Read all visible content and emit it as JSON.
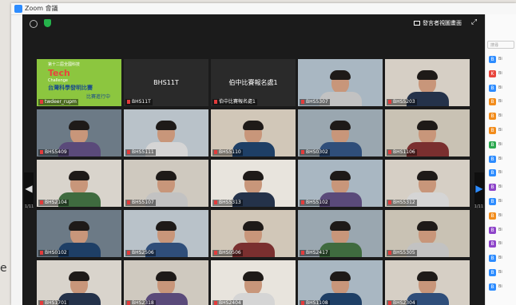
{
  "window": {
    "title": "Zoom 會議"
  },
  "toolbar": {
    "view_label": "發言者視圖畫面",
    "fullscreen_icon": "fullscreen-icon"
  },
  "navigation": {
    "prev_page": "1/11",
    "next_page": "1/11"
  },
  "sidebar": {
    "search_placeholder": "搜尋",
    "items": [
      {
        "avatar": "B",
        "label": "Bi",
        "color": "#2d8cff"
      },
      {
        "avatar": "K",
        "label": "Bi",
        "color": "#e8453c"
      },
      {
        "avatar": "B",
        "label": "Bi",
        "color": "#2d8cff"
      },
      {
        "avatar": "B",
        "label": "Bi",
        "color": "#f28c1b"
      },
      {
        "avatar": "B",
        "label": "Bi",
        "color": "#f28c1b"
      },
      {
        "avatar": "B",
        "label": "Bi",
        "color": "#f28c1b"
      },
      {
        "avatar": "B",
        "label": "Bi",
        "color": "#2ca84f"
      },
      {
        "avatar": "B",
        "label": "Bi",
        "color": "#2d8cff"
      },
      {
        "avatar": "B",
        "label": "Bi",
        "color": "#2d8cff"
      },
      {
        "avatar": "B",
        "label": "Bi",
        "color": "#8e44c9"
      },
      {
        "avatar": "B",
        "label": "Bi",
        "color": "#2d8cff"
      },
      {
        "avatar": "B",
        "label": "Bi",
        "color": "#f28c1b"
      },
      {
        "avatar": "B",
        "label": "Bi",
        "color": "#8e44c9"
      },
      {
        "avatar": "B",
        "label": "Bi",
        "color": "#8e44c9"
      },
      {
        "avatar": "B",
        "label": "Bi",
        "color": "#2d8cff"
      },
      {
        "avatar": "B",
        "label": "Bi",
        "color": "#2d8cff"
      },
      {
        "avatar": "B",
        "label": "Bi",
        "color": "#2d8cff"
      }
    ]
  },
  "tiles": [
    {
      "name": "twdeer_rupm",
      "type": "banner",
      "banner_top": "第十二屆全國科技",
      "banner_brand": "Tech",
      "banner_sub": "Challenge",
      "banner_main": "台灣科學發明比賽",
      "banner_foot": "比賽進行中"
    },
    {
      "name": "BHS11T",
      "type": "label"
    },
    {
      "name": "伯中比賽報名處1",
      "type": "label"
    },
    {
      "name": "BHS5307",
      "type": "video"
    },
    {
      "name": "BHS5203",
      "type": "video"
    },
    {
      "name": "BHS5409",
      "type": "video"
    },
    {
      "name": "BHS5111",
      "type": "video"
    },
    {
      "name": "BHS5110",
      "type": "video"
    },
    {
      "name": "BHS0302",
      "type": "video"
    },
    {
      "name": "BHS1106",
      "type": "video"
    },
    {
      "name": "BHS2104",
      "type": "video"
    },
    {
      "name": "BHS5107",
      "type": "video"
    },
    {
      "name": "BHS5313",
      "type": "video"
    },
    {
      "name": "BHS5102",
      "type": "video"
    },
    {
      "name": "BHS5312",
      "type": "video"
    },
    {
      "name": "BHS0102",
      "type": "video"
    },
    {
      "name": "BHS2506",
      "type": "video"
    },
    {
      "name": "BHS0506",
      "type": "video"
    },
    {
      "name": "BHS2417",
      "type": "video"
    },
    {
      "name": "BHS5305",
      "type": "video"
    },
    {
      "name": "BHS1701",
      "type": "video"
    },
    {
      "name": "BHS2318",
      "type": "video"
    },
    {
      "name": "BHS2404",
      "type": "video"
    },
    {
      "name": "BHS1108",
      "type": "video"
    },
    {
      "name": "BHS2304",
      "type": "video"
    }
  ],
  "page_fragment": "e"
}
